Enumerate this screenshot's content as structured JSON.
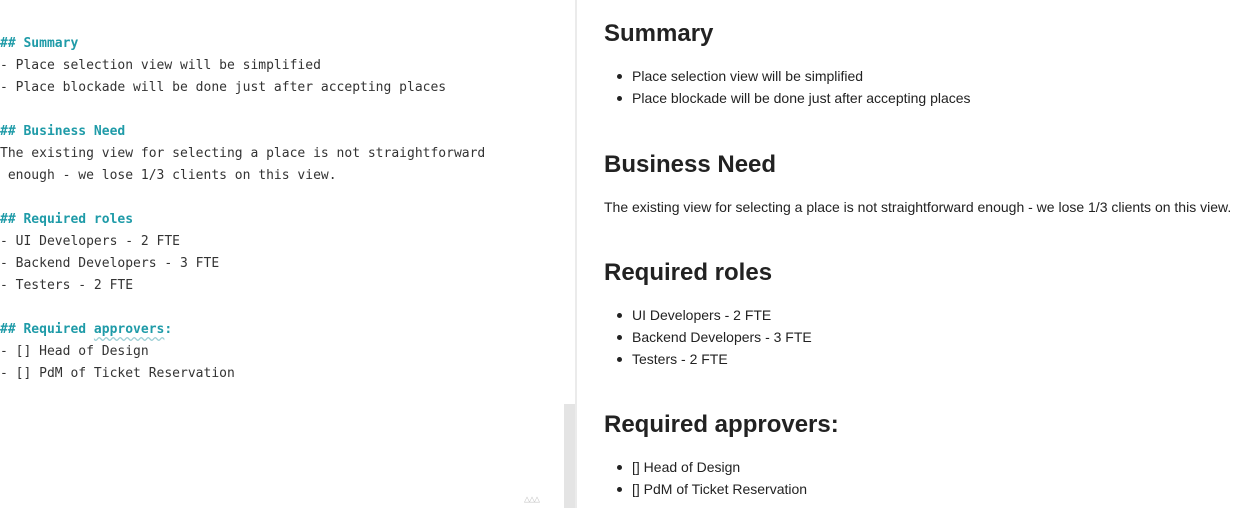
{
  "editor": {
    "lines": [
      {
        "text": "## Summary",
        "kind": "heading"
      },
      {
        "text": "- Place selection view will be simplified",
        "kind": "text"
      },
      {
        "text": "- Place blockade will be done just after accepting places",
        "kind": "text"
      },
      {
        "text": "",
        "kind": "blank"
      },
      {
        "text": "## Business Need",
        "kind": "heading"
      },
      {
        "text": "The existing view for selecting a place is not straightforward",
        "kind": "text"
      },
      {
        "text": " enough - we lose 1/3 clients on this view.",
        "kind": "text"
      },
      {
        "text": "",
        "kind": "blank"
      },
      {
        "text": "## Required roles",
        "kind": "heading"
      },
      {
        "text": "- UI Developers - 2 FTE",
        "kind": "text"
      },
      {
        "text": "- Backend Developers - 3 FTE",
        "kind": "text"
      },
      {
        "text": "- Testers - 2 FTE",
        "kind": "text"
      },
      {
        "text": "",
        "kind": "blank"
      },
      {
        "text": "## Required ",
        "kind": "heading"
      },
      {
        "text": "- [] Head of Design",
        "kind": "text"
      },
      {
        "text": "- [] PdM of Ticket Reservation",
        "kind": "text"
      }
    ],
    "approvers_word": "approvers",
    "approvers_suffix": ":",
    "resize_grip": "△△△"
  },
  "preview": {
    "summary_title": "Summary",
    "summary_items": [
      "Place selection view will be simplified",
      "Place blockade will be done just after accepting places"
    ],
    "business_title": "Business Need",
    "business_text": "The existing view for selecting a place is not straightforward enough - we lose 1/3 clients on this view.",
    "roles_title": "Required roles",
    "roles_items": [
      "UI Developers - 2 FTE",
      "Backend Developers - 3 FTE",
      "Testers - 2 FTE"
    ],
    "approvers_title": "Required approvers:",
    "approvers_items": [
      "[] Head of Design",
      "[] PdM of Ticket Reservation"
    ]
  }
}
